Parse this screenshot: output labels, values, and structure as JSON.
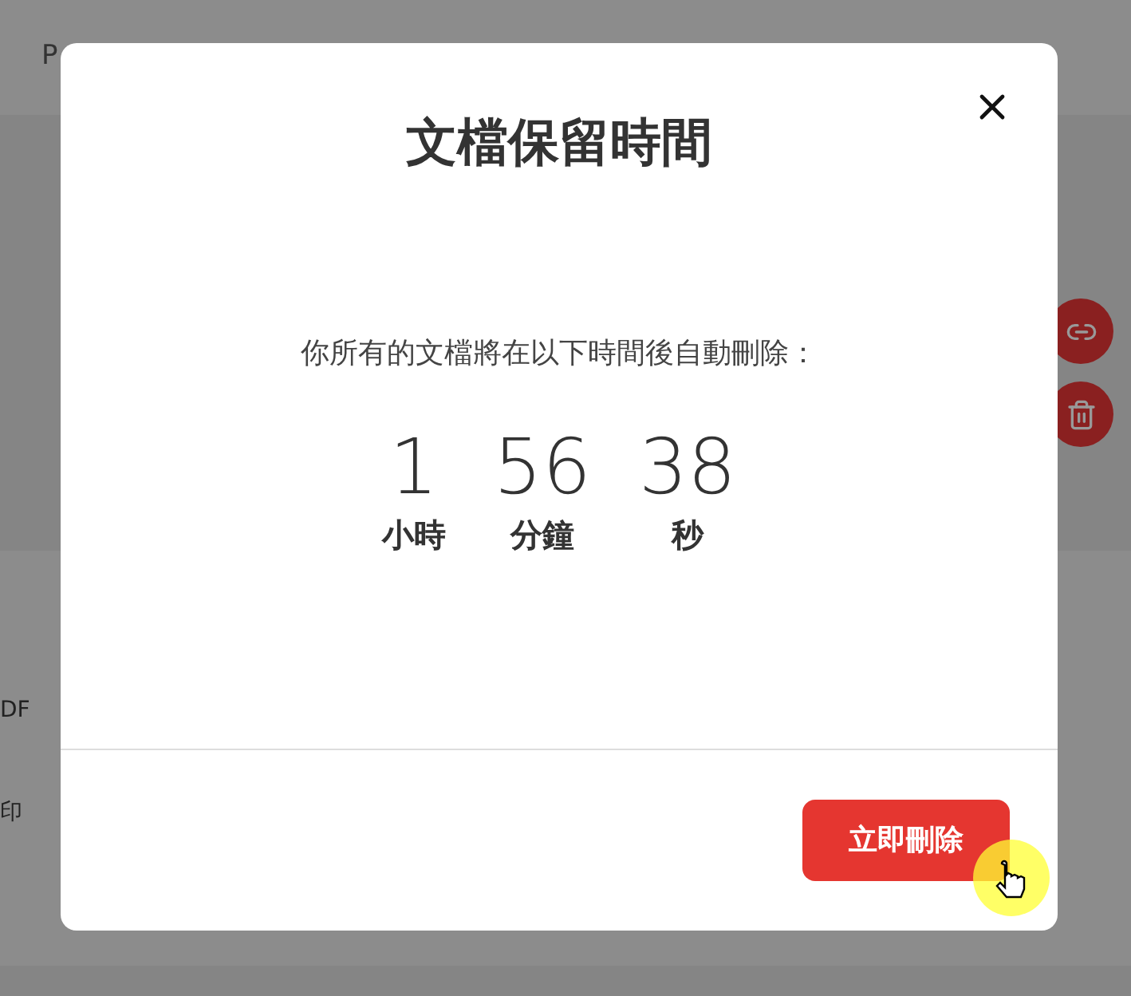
{
  "background": {
    "header_text": "P",
    "side_texts": [
      "DF",
      "印"
    ]
  },
  "dialog": {
    "title": "文檔保留時間",
    "message": "你所有的文檔將在以下時間後自動刪除：",
    "countdown": [
      {
        "value": "1",
        "unit": "小時"
      },
      {
        "value": "56",
        "unit": "分鐘"
      },
      {
        "value": "38",
        "unit": "秒"
      }
    ],
    "button": "立即刪除"
  }
}
